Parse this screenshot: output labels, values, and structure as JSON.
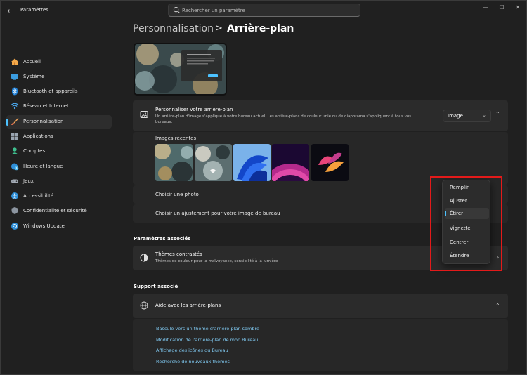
{
  "window": {
    "title": "Paramètres",
    "search_placeholder": "Rechercher un paramètre",
    "controls": [
      "minimize-icon",
      "maximize-icon",
      "close-icon"
    ]
  },
  "sidebar": {
    "items": [
      {
        "label": "Accueil",
        "icon": "home-icon"
      },
      {
        "label": "Système",
        "icon": "system-icon"
      },
      {
        "label": "Bluetooth et appareils",
        "icon": "bluetooth-icon"
      },
      {
        "label": "Réseau et Internet",
        "icon": "network-icon"
      },
      {
        "label": "Personnalisation",
        "icon": "brush-icon",
        "active": true
      },
      {
        "label": "Applications",
        "icon": "apps-icon"
      },
      {
        "label": "Comptes",
        "icon": "account-icon"
      },
      {
        "label": "Heure et langue",
        "icon": "globe-clock-icon"
      },
      {
        "label": "Jeux",
        "icon": "gamepad-icon"
      },
      {
        "label": "Accessibilité",
        "icon": "accessibility-icon"
      },
      {
        "label": "Confidentialité et sécurité",
        "icon": "shield-icon"
      },
      {
        "label": "Windows Update",
        "icon": "update-icon"
      }
    ]
  },
  "breadcrumb": {
    "parent": "Personnalisation",
    "separator": ">",
    "current": "Arrière-plan"
  },
  "background_card": {
    "title": "Personnaliser votre arrière-plan",
    "description": "Un arrière-plan d'image s'applique à votre bureau actuel. Les arrière-plans de couleur unie ou de diaporama s'appliquent à tous vos bureaux.",
    "select_value": "Image",
    "recent_images_label": "Images récentes",
    "choose_photo_label": "Choisir une photo",
    "fit_label": "Choisir un ajustement pour votre image de bureau"
  },
  "fit_menu": {
    "options": [
      "Remplir",
      "Ajuster",
      "Étirer",
      "Vignette",
      "Centrer",
      "Étendre"
    ],
    "selected": "Étirer"
  },
  "related_settings": {
    "heading": "Paramètres associés",
    "contrast_title": "Thèmes contrastés",
    "contrast_desc": "Thèmes de couleur pour la malvoyance, sensibilité à la lumière"
  },
  "support": {
    "heading": "Support associé",
    "help_title": "Aide avec les arrière-plans",
    "links": [
      "Bascule vers un thème d'arrière-plan sombre",
      "Modification de l'arrière-plan de mon Bureau",
      "Affichage des icônes du Bureau",
      "Recherche de nouveaux thèmes"
    ]
  },
  "colors": {
    "accent": "#4cc2ff",
    "link": "#7fc8f0",
    "highlight_box": "#e31a1a"
  }
}
